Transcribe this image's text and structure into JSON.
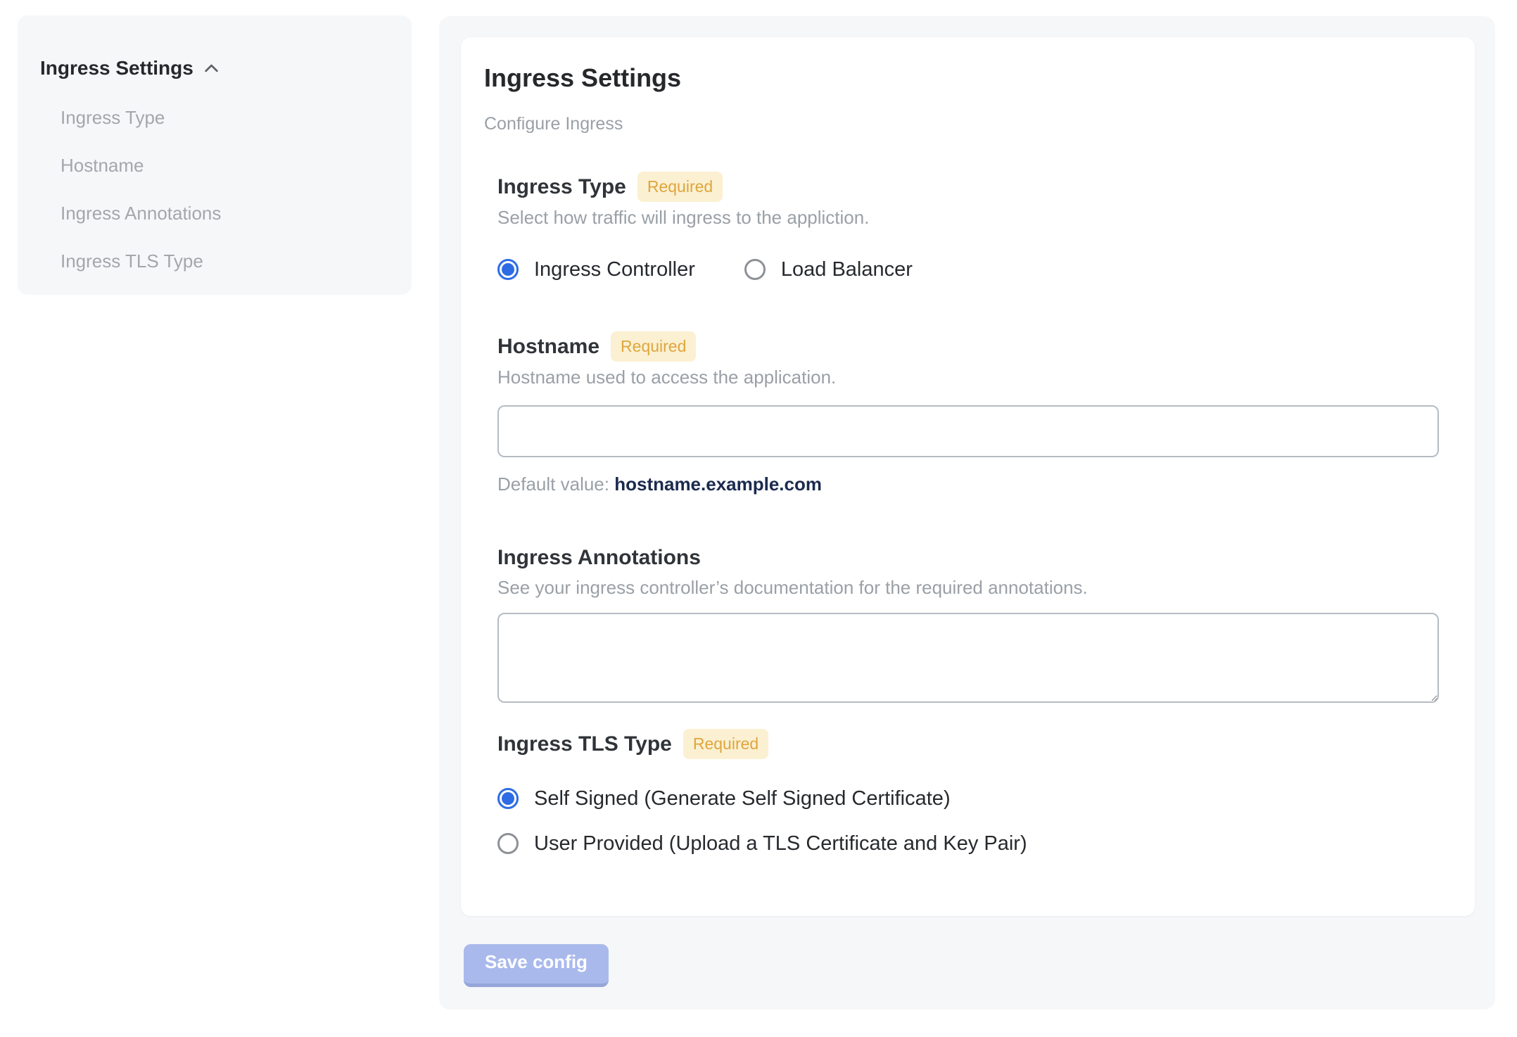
{
  "colors": {
    "panel_bg": "#f6f7f9",
    "accent_blue": "#2e6ce4",
    "badge_bg": "#fbf0d2",
    "badge_text": "#dfa63d",
    "muted_text": "#9aa0a6",
    "navy_value_text": "#1b2a4e",
    "save_button_bg": "#aab9ec"
  },
  "sidebar": {
    "header": "Ingress Settings",
    "collapse_icon": "chevron-up-icon",
    "items": [
      {
        "label": "Ingress Type"
      },
      {
        "label": "Hostname"
      },
      {
        "label": "Ingress Annotations"
      },
      {
        "label": "Ingress TLS Type"
      }
    ]
  },
  "main": {
    "title": "Ingress Settings",
    "subtitle": "Configure Ingress",
    "required_label": "Required",
    "sections": {
      "ingress_type": {
        "title": "Ingress Type",
        "required": true,
        "description": "Select how traffic will ingress to the appliction.",
        "options": [
          {
            "label": "Ingress Controller",
            "selected": true
          },
          {
            "label": "Load Balancer",
            "selected": false
          }
        ]
      },
      "hostname": {
        "title": "Hostname",
        "required": true,
        "description": "Hostname used to access the application.",
        "input_value": "",
        "default_value_label": "Default value: ",
        "default_value": "hostname.example.com"
      },
      "ingress_annotations": {
        "title": "Ingress Annotations",
        "required": false,
        "description": "See your ingress controller’s documentation for the required annotations.",
        "textarea_value": ""
      },
      "ingress_tls_type": {
        "title": "Ingress TLS Type",
        "required": true,
        "options": [
          {
            "label": "Self Signed (Generate Self Signed Certificate)",
            "selected": true
          },
          {
            "label": "User Provided (Upload a TLS Certificate and Key Pair)",
            "selected": false
          }
        ]
      }
    },
    "save_button": "Save config"
  }
}
